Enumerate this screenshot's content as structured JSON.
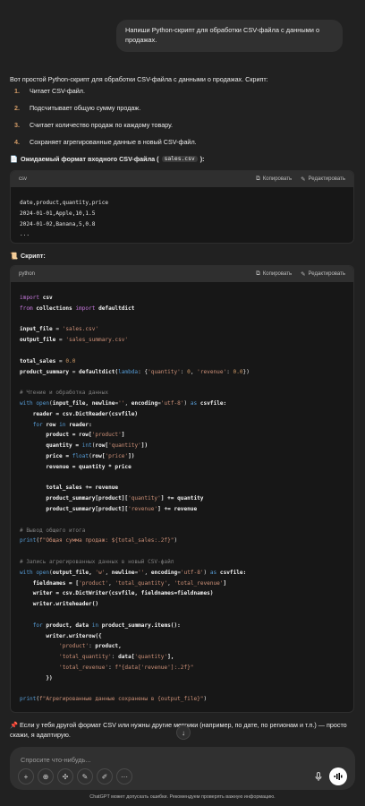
{
  "user_message": "Напиши Python-скрипт для обработки CSV-файла с данными о продажах.",
  "intro": "Вот простой Python-скрипт для обработки CSV-файла с данными о продажах. Скрипт:",
  "steps": [
    {
      "n": "1.",
      "text": "Читает CSV-файл."
    },
    {
      "n": "2.",
      "text": "Подсчитывает общую сумму продаж."
    },
    {
      "n": "3.",
      "text": "Считает количество продаж по каждому товару."
    },
    {
      "n": "4.",
      "text": "Сохраняет агрегированные данные в новый CSV-файл."
    }
  ],
  "input_format": {
    "emoji": "📄",
    "title": "Ожидаемый формат входного CSV-файла (",
    "filename": "sales.csv",
    "title_end": "):"
  },
  "csv_block": {
    "lang": "csv",
    "copy": "Копировать",
    "edit": "Редактировать",
    "lines": [
      "date,product,quantity,price",
      "2024-01-01,Apple,10,1.5",
      "2024-01-02,Banana,5,0.8",
      "..."
    ]
  },
  "script_heading": {
    "emoji": "📜",
    "title": "Скрипт:"
  },
  "python_block": {
    "lang": "python",
    "copy": "Копировать",
    "edit": "Редактировать"
  },
  "footer_note": {
    "emoji": "📌",
    "text": "Если у тебя другой формат CSV или нужны другие метрики (например, по дате, по регионам и т.п.) — просто скажи, я адаптирую."
  },
  "composer": {
    "placeholder": "Спросите что-нибудь...",
    "tools": [
      "plus-icon",
      "globe-icon",
      "settings-icon",
      "pen-icon",
      "brush-icon",
      "more-icon"
    ],
    "mic": "mic-icon",
    "voice": "voice-mode-icon"
  },
  "disclaimer": "ChatGPT может допускать ошибки. Рекомендуем проверять важную информацию."
}
